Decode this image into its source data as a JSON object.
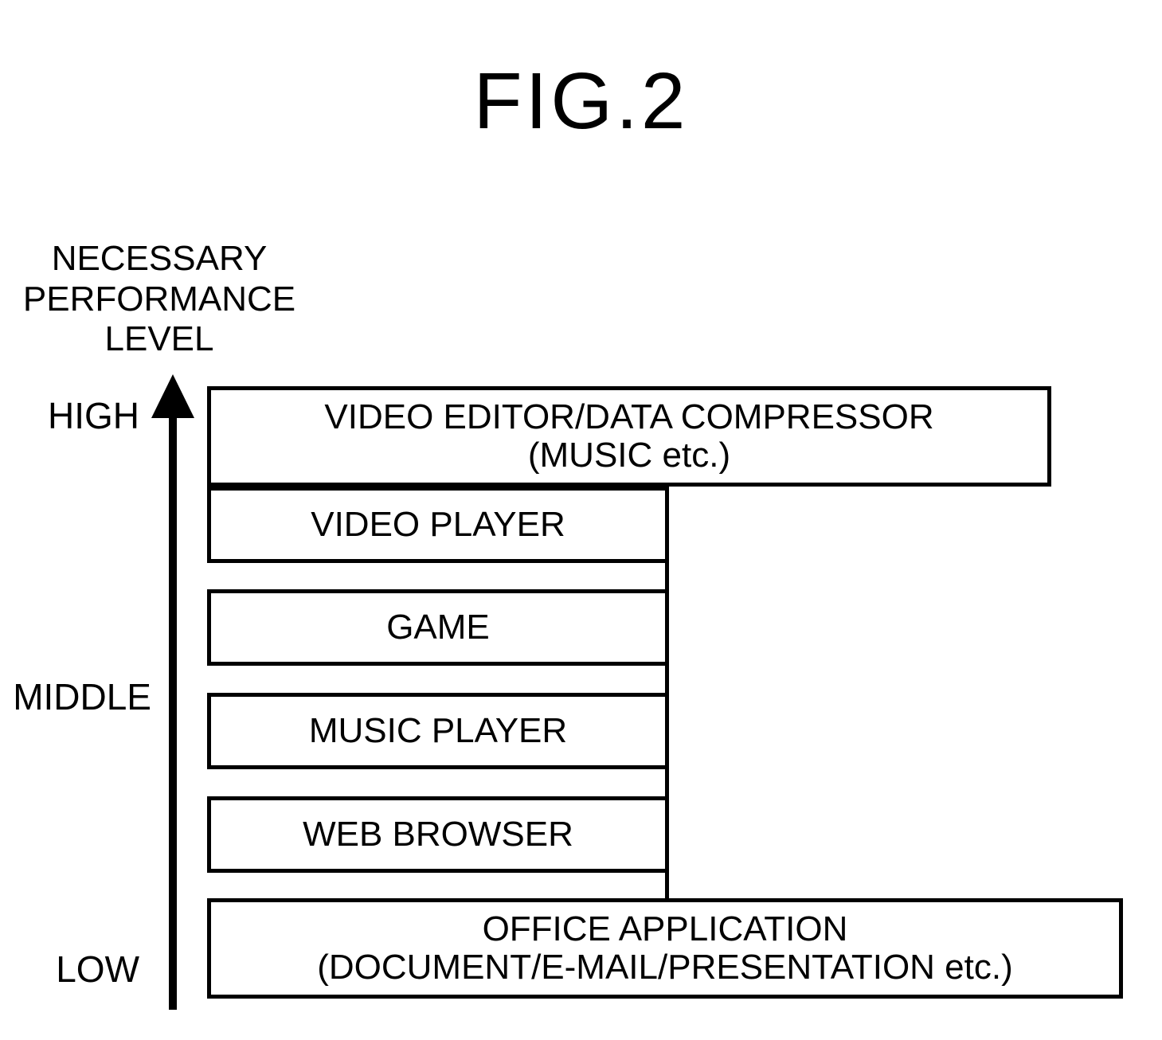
{
  "title": "FIG.2",
  "axis": {
    "heading_l1": "NECESSARY",
    "heading_l2": "PERFORMANCE",
    "heading_l3": "LEVEL",
    "high": "HIGH",
    "middle": "MIDDLE",
    "low": "LOW"
  },
  "rows": {
    "r1_l1": "VIDEO EDITOR/DATA COMPRESSOR",
    "r1_l2": "(MUSIC etc.)",
    "r2": "VIDEO PLAYER",
    "r3": "GAME",
    "r4": "MUSIC PLAYER",
    "r5": "WEB BROWSER",
    "r6_l1": "OFFICE APPLICATION",
    "r6_l2": "(DOCUMENT/E-MAIL/PRESENTATION etc.)"
  },
  "chart_data": {
    "type": "bar",
    "title": "FIG.2",
    "ylabel": "NECESSARY PERFORMANCE LEVEL",
    "y_scale": [
      "LOW",
      "MIDDLE",
      "HIGH"
    ],
    "note": "Bar width represents relative usage share (wide/medium). Vertical position represents required performance level (ordinal).",
    "items": [
      {
        "name": "VIDEO EDITOR/DATA COMPRESSOR (MUSIC etc.)",
        "performance_level": "HIGH",
        "usage_share": "wide"
      },
      {
        "name": "VIDEO PLAYER",
        "performance_level": "HIGH-MIDDLE",
        "usage_share": "medium"
      },
      {
        "name": "GAME",
        "performance_level": "MIDDLE",
        "usage_share": "medium"
      },
      {
        "name": "MUSIC PLAYER",
        "performance_level": "MIDDLE",
        "usage_share": "medium"
      },
      {
        "name": "WEB BROWSER",
        "performance_level": "MIDDLE-LOW",
        "usage_share": "medium"
      },
      {
        "name": "OFFICE APPLICATION (DOCUMENT/E-MAIL/PRESENTATION etc.)",
        "performance_level": "LOW",
        "usage_share": "wide"
      }
    ]
  }
}
